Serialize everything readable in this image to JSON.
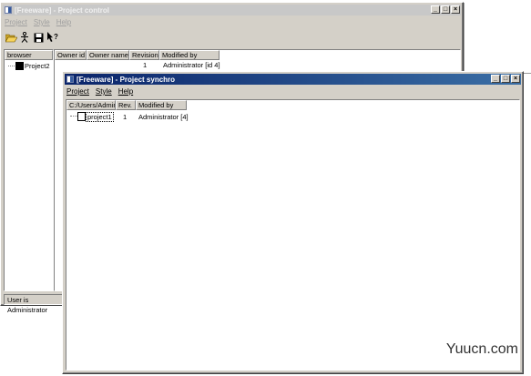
{
  "project_control": {
    "title": "[Freeware] - Project control",
    "menu": [
      "Project",
      "Style",
      "Help"
    ],
    "toolbar_icons": [
      "open-folder-icon",
      "person-icon",
      "save-icon",
      "help-pointer-icon"
    ],
    "browser_header": "browser",
    "tree_item": "Project2",
    "columns": [
      "Owner id",
      "Owner name",
      "Revision",
      "Modified by"
    ],
    "row": {
      "owner_id": "",
      "owner_name": "",
      "revision": "1",
      "modified_by": "Administrator [id 4]"
    },
    "status": "User is Administrator"
  },
  "project_synchro": {
    "title": "[Freeware] - Project synchro",
    "menu": [
      "Project",
      "Style",
      "Help"
    ],
    "columns": [
      "C:/Users/Admin",
      "Rev.",
      "Modified by"
    ],
    "row": {
      "name": "project1",
      "rev": "1",
      "modified_by": "Administrator [4]"
    }
  },
  "title_buttons": {
    "minimize": "_",
    "maximize": "□",
    "close": "×"
  },
  "watermark": "Yuucn.com"
}
